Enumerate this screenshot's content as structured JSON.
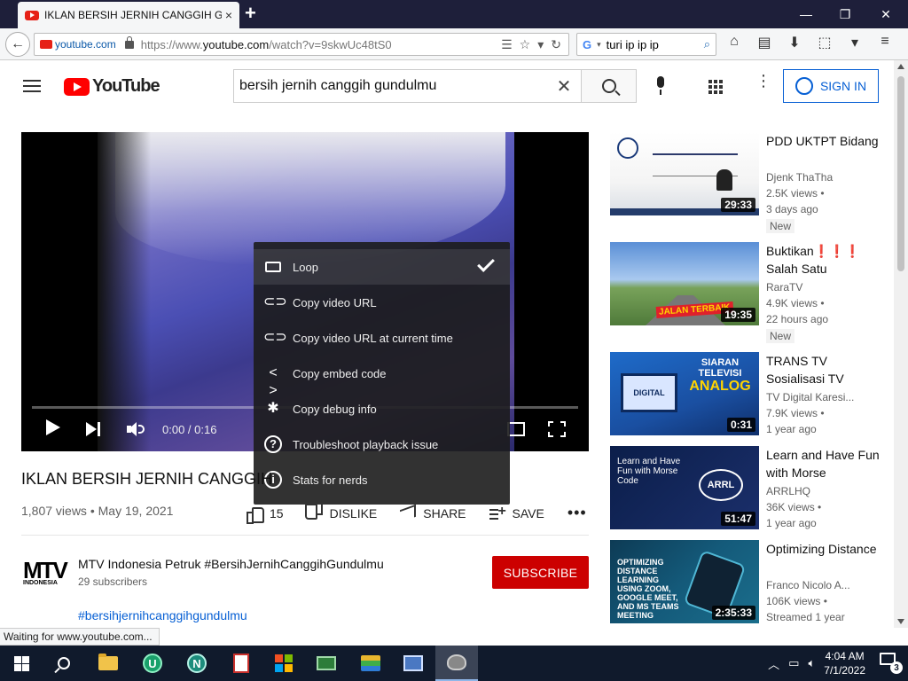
{
  "browser": {
    "tab_title": "IKLAN BERSIH JERNIH CANGGIH GUN...",
    "tab_close": "×",
    "new_tab": "+",
    "window_minimize": "—",
    "window_restore": "❐",
    "window_close": "✕",
    "site_label": "youtube.com",
    "url_prefix": "https://www.",
    "url_host": "youtube.com",
    "url_path": "/watch?v=9skwUc48tS0",
    "search_engine_value": "turi ip ip ip",
    "status_text": "Waiting for www.youtube.com..."
  },
  "youtube": {
    "logo_text": "YouTube",
    "search_value": "bersih jernih canggih gundulmu",
    "signin_label": "SIGN IN"
  },
  "player": {
    "time_display": "0:00 / 0:16",
    "progress_fraction": 0,
    "context_menu": [
      {
        "label": "Loop",
        "icon": "loop-icon",
        "checked": true
      },
      {
        "label": "Copy video URL",
        "icon": "link-icon"
      },
      {
        "label": "Copy video URL at current time",
        "icon": "link-icon"
      },
      {
        "label": "Copy embed code",
        "icon": "code-icon"
      },
      {
        "label": "Copy debug info",
        "icon": "bug-icon"
      },
      {
        "label": "Troubleshoot playback issue",
        "icon": "help-icon"
      },
      {
        "label": "Stats for nerds",
        "icon": "info-icon"
      }
    ]
  },
  "video": {
    "title": "IKLAN BERSIH JERNIH CANGGIH",
    "views": "1,807 views",
    "date": "May 19, 2021",
    "likes": "15",
    "dislike_label": "DISLIKE",
    "share_label": "SHARE",
    "save_label": "SAVE",
    "more_label": "•••",
    "channel_name": "MTV Indonesia Petruk #BersihJernihCanggihGundulmu",
    "channel_subs": "29 subscribers",
    "channel_logo_main": "MTV",
    "channel_logo_sub": "INDONESIA",
    "subscribe_label": "SUBSCRIBE",
    "hashtag": "#bersihjernihcanggihgundulmu"
  },
  "recommendations": [
    {
      "title": "PDD UKTPT Bidang",
      "channel": "Djenk ThaTha",
      "views": "2.5K views •",
      "ago": "3 days ago",
      "badge": "New",
      "duration": "29:33"
    },
    {
      "title": "Buktikan❗❗❗ Salah Satu",
      "channel": "RaraTV",
      "views": "4.9K views •",
      "ago": "22 hours ago",
      "badge": "New",
      "duration": "19:35",
      "thumb_tag": "JALAN TERBAIK"
    },
    {
      "title": "TRANS TV Sosialisasi TV",
      "channel": "TV Digital Karesi...",
      "views": "7.9K views •",
      "ago": "1 year ago",
      "duration": "0:31",
      "thumb_text_a": "DIGITAL",
      "thumb_text_b": "SIARAN TELEVISI",
      "thumb_text_c": "ANALOG"
    },
    {
      "title": "Learn and Have Fun with Morse",
      "channel": "ARRLHQ",
      "views": "36K views •",
      "ago": "1 year ago",
      "duration": "51:47",
      "thumb_text_a": "Learn and Have Fun with Morse Code",
      "thumb_text_b": "ARRL"
    },
    {
      "title": "Optimizing Distance",
      "channel": "Franco Nicolo A...",
      "views": "106K views •",
      "ago": "Streamed 1 year",
      "duration": "2:35:33",
      "thumb_text_a": "OPTIMIZING DISTANCE LEARNING USING ZOOM, GOOGLE MEET, AND MS TEAMS MEETING"
    }
  ],
  "taskbar": {
    "time": "4:04 AM",
    "date": "7/1/2022",
    "notification_count": "3"
  }
}
